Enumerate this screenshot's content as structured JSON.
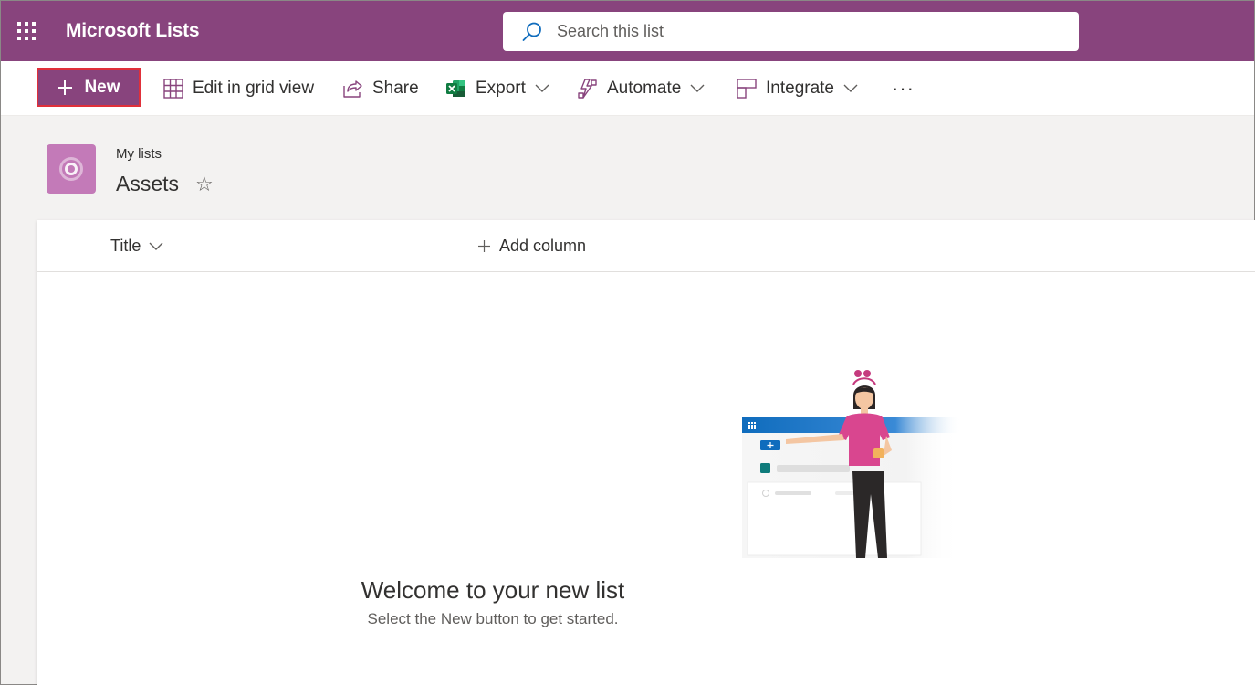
{
  "suite_bar": {
    "app_title": "Microsoft Lists",
    "search_placeholder": "Search this list",
    "background_color": "#88447d"
  },
  "command_bar": {
    "new_label": "New",
    "edit_grid_label": "Edit in grid view",
    "share_label": "Share",
    "export_label": "Export",
    "automate_label": "Automate",
    "integrate_label": "Integrate",
    "more_label": "···"
  },
  "header": {
    "breadcrumb": "My lists",
    "list_title": "Assets",
    "favorite_glyph": "☆",
    "list_icon": "target-icon",
    "list_icon_color": "#c37ab8"
  },
  "columns": {
    "title_label": "Title",
    "add_column_label": "Add column"
  },
  "empty_state": {
    "title": "Welcome to your new list",
    "subtitle": "Select the New button to get started."
  },
  "colors": {
    "accent": "#88447d",
    "highlight_border": "#e0303a",
    "excel_green": "#1d6f42"
  }
}
